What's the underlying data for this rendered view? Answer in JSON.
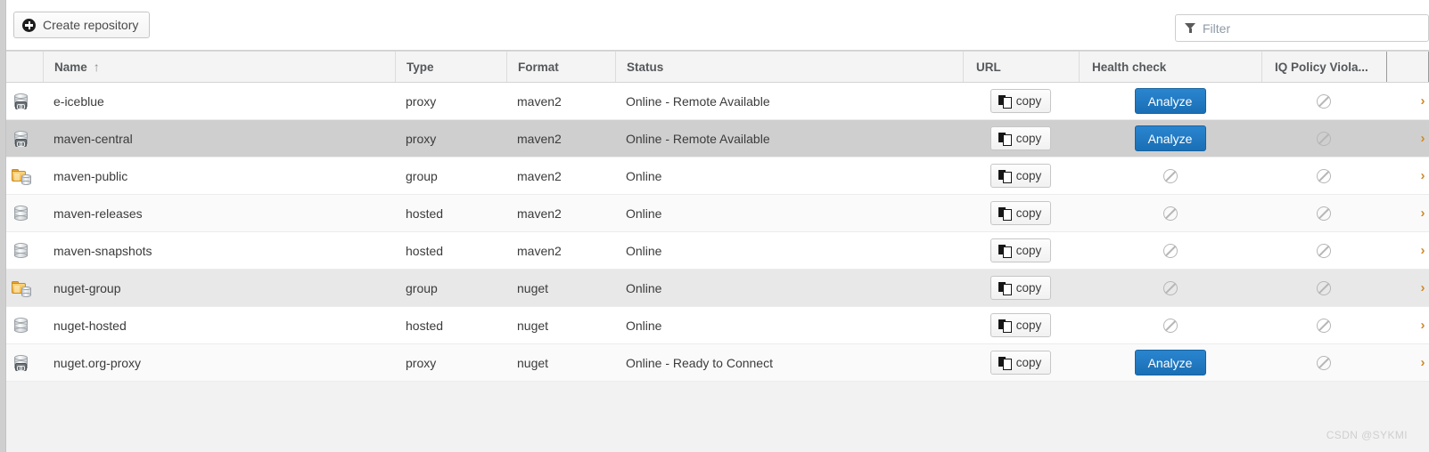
{
  "toolbar": {
    "create_button_label": "Create repository",
    "create_button_icon": "plus-circle-icon",
    "filter_placeholder": "Filter",
    "filter_value": "",
    "filter_icon": "funnel-icon"
  },
  "table": {
    "columns": [
      {
        "key": "icon",
        "label": ""
      },
      {
        "key": "name",
        "label": "Name",
        "sorted": true,
        "sort_arrow": "↑"
      },
      {
        "key": "type",
        "label": "Type"
      },
      {
        "key": "format",
        "label": "Format"
      },
      {
        "key": "status",
        "label": "Status"
      },
      {
        "key": "url",
        "label": "URL"
      },
      {
        "key": "health",
        "label": "Health check"
      },
      {
        "key": "iq",
        "label": "IQ Policy Viola..."
      },
      {
        "key": "last",
        "label": ""
      }
    ],
    "copy_button_label": "copy",
    "copy_button_icon": "copy-pages-icon",
    "analyze_button_label": "Analyze",
    "disabled_icon": "prohibited-icon",
    "edge_glyph": "›",
    "rows": [
      {
        "icon": "proxy-repository-icon",
        "name": "e-iceblue",
        "type": "proxy",
        "format": "maven2",
        "status": "Online - Remote Available",
        "url_action": "copy",
        "health": "analyze",
        "iq": "disabled",
        "row_state": "normal"
      },
      {
        "icon": "proxy-repository-icon",
        "name": "maven-central",
        "type": "proxy",
        "format": "maven2",
        "status": "Online - Remote Available",
        "url_action": "copy",
        "health": "analyze",
        "iq": "disabled",
        "row_state": "selected"
      },
      {
        "icon": "group-repository-icon",
        "name": "maven-public",
        "type": "group",
        "format": "maven2",
        "status": "Online",
        "url_action": "copy",
        "health": "disabled",
        "iq": "disabled",
        "row_state": "normal"
      },
      {
        "icon": "hosted-repository-icon",
        "name": "maven-releases",
        "type": "hosted",
        "format": "maven2",
        "status": "Online",
        "url_action": "copy",
        "health": "disabled",
        "iq": "disabled",
        "row_state": "alt"
      },
      {
        "icon": "hosted-repository-icon",
        "name": "maven-snapshots",
        "type": "hosted",
        "format": "maven2",
        "status": "Online",
        "url_action": "copy",
        "health": "disabled",
        "iq": "disabled",
        "row_state": "normal"
      },
      {
        "icon": "group-repository-icon",
        "name": "nuget-group",
        "type": "group",
        "format": "nuget",
        "status": "Online",
        "url_action": "copy",
        "health": "disabled",
        "iq": "disabled",
        "row_state": "hover"
      },
      {
        "icon": "hosted-repository-icon",
        "name": "nuget-hosted",
        "type": "hosted",
        "format": "nuget",
        "status": "Online",
        "url_action": "copy",
        "health": "disabled",
        "iq": "disabled",
        "row_state": "normal"
      },
      {
        "icon": "proxy-repository-icon",
        "name": "nuget.org-proxy",
        "type": "proxy",
        "format": "nuget",
        "status": "Online - Ready to Connect",
        "url_action": "copy",
        "health": "analyze",
        "iq": "disabled",
        "row_state": "alt"
      }
    ]
  },
  "watermark": "CSDN @SYKMI",
  "colors": {
    "primary_button": "#1a6fb5",
    "selected_row": "#cfcfcf",
    "hover_row": "#e8e8e8",
    "alt_row": "#fafafa",
    "header_bg": "#f4f4f4",
    "page_bg": "#f2f2f2",
    "folder_icon": "#f0b23f"
  }
}
